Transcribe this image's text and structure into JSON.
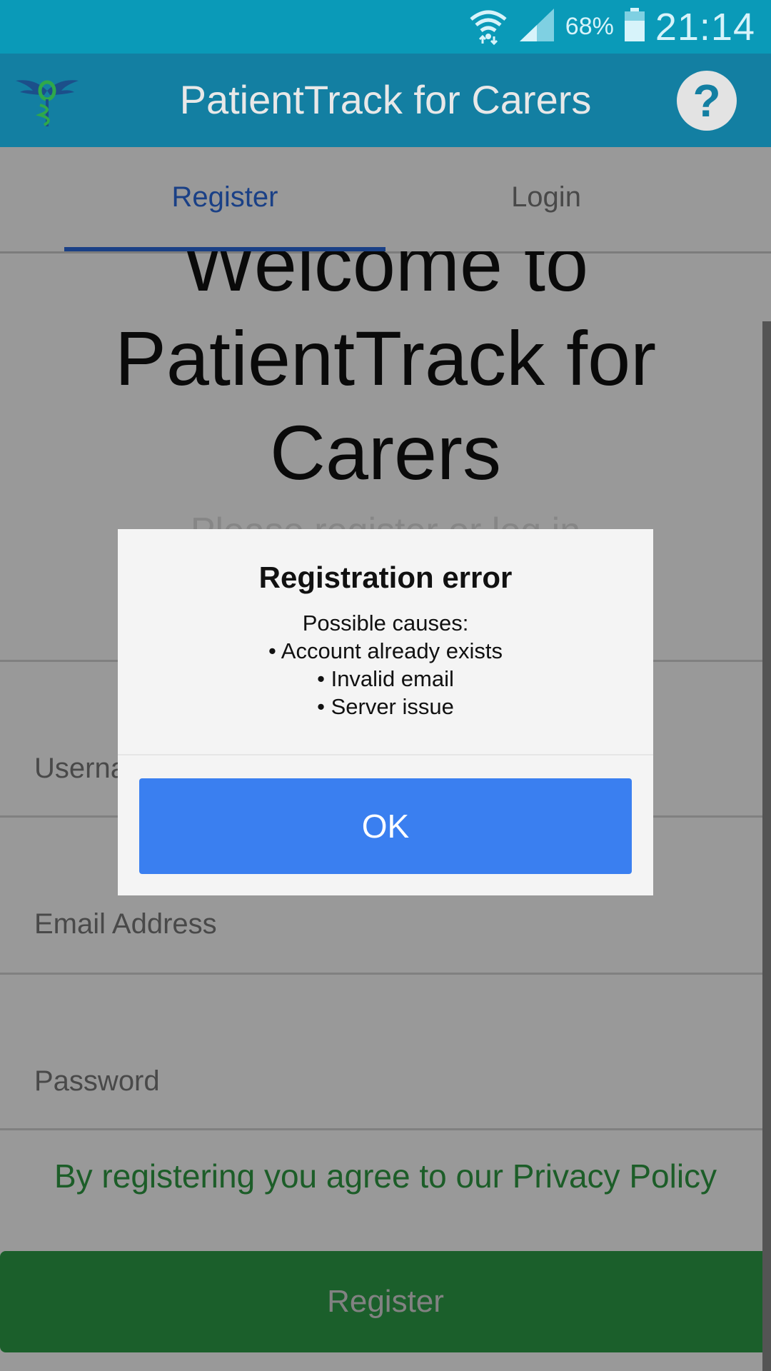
{
  "status_bar": {
    "battery": "68%",
    "time": "21:14",
    "icons": [
      "wifi-icon",
      "signal-icon",
      "battery-icon"
    ]
  },
  "app_bar": {
    "title": "PatientTrack for Carers",
    "logo_icon": "caduceus-logo",
    "help_label": "?"
  },
  "tabs": [
    {
      "label": "Register",
      "active": true
    },
    {
      "label": "Login",
      "active": false
    }
  ],
  "main": {
    "welcome_title": "Welcome to PatientTrack for Carers",
    "subtitle": "Please register or log in",
    "fields": {
      "username_placeholder": "Username",
      "email_placeholder": "Email Address",
      "password_placeholder": "Password"
    },
    "privacy_text": "By registering you agree to our Privacy Policy",
    "register_button": "Register"
  },
  "dialog": {
    "title": "Registration error",
    "lines": [
      "Possible causes:",
      "• Account already exists",
      "• Invalid email",
      "• Server issue"
    ],
    "ok_label": "OK"
  },
  "colors": {
    "status_bar": "#0a9ab8",
    "app_bar": "#137fa2",
    "accent_blue": "#2c6ce0",
    "ok_button": "#3a7ff0",
    "register_green": "#2e9e48",
    "privacy_green": "#2f9c43"
  }
}
